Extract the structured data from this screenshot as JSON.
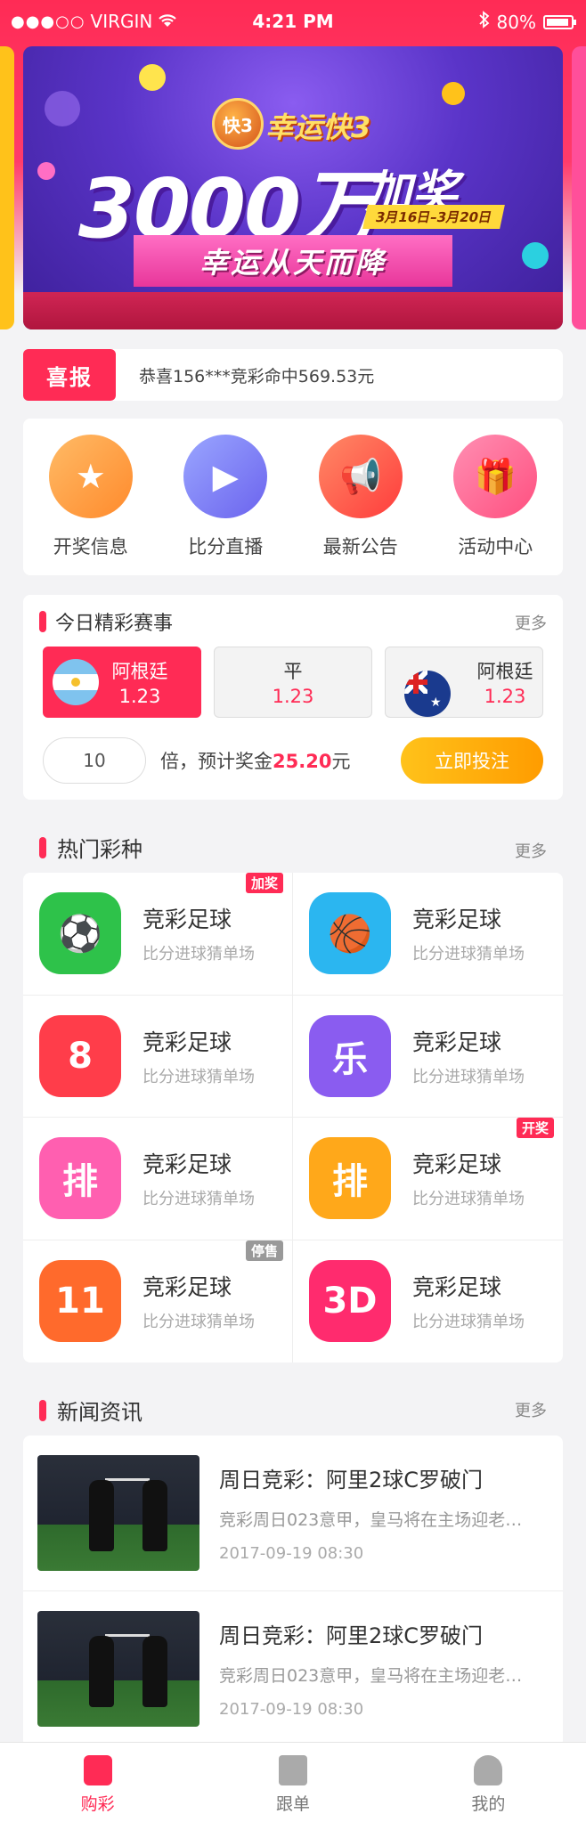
{
  "status_bar": {
    "carrier": "VIRGIN",
    "time": "4:21 PM",
    "battery": "80%"
  },
  "banner": {
    "logo_text": "快3",
    "subtitle": "幸运快3",
    "amount": "3000万",
    "bonus": "加奖",
    "date_range": "3月16日–3月20日",
    "slogan": "幸运从天而降"
  },
  "notice": {
    "tag": "喜报",
    "text": "恭喜156***竞彩命中569.53元"
  },
  "quick_entries": [
    {
      "label": "开奖信息",
      "icon": "award-icon",
      "color": "#ff9a3c"
    },
    {
      "label": "比分直播",
      "icon": "video-icon",
      "color": "#7c7cf0"
    },
    {
      "label": "最新公告",
      "icon": "megaphone-icon",
      "color": "#ff5a3c"
    },
    {
      "label": "活动中心",
      "icon": "gift-icon",
      "color": "#ff5f8f"
    }
  ],
  "match": {
    "title": "今日精彩赛事",
    "more": "更多",
    "home": {
      "name": "阿根廷",
      "odd": "1.23"
    },
    "draw": {
      "name": "平",
      "odd": "1.23"
    },
    "away": {
      "name": "阿根廷",
      "odd": "1.23"
    },
    "multiple": "10",
    "bet_prefix": "倍，预计奖金",
    "bet_amount": "25.20",
    "bet_suffix": "元",
    "bet_button": "立即投注"
  },
  "hot_lottery": {
    "title": "热门彩种",
    "more": "更多",
    "items": [
      {
        "name": "竞彩足球",
        "desc": "比分进球猜单场",
        "badge": "加奖",
        "badge_color": "#ff2b55",
        "icon": "soccer-ball-icon",
        "color": "#2ec24a"
      },
      {
        "name": "竞彩足球",
        "desc": "比分进球猜单场",
        "badge": "",
        "badge_color": "",
        "icon": "basketball-icon",
        "color": "#2bb6f0"
      },
      {
        "name": "竞彩足球",
        "desc": "比分进球猜单场",
        "badge": "",
        "badge_color": "",
        "icon": "lottery-ball-8-icon",
        "color": "#ff3d4a"
      },
      {
        "name": "竞彩足球",
        "desc": "比分进球猜单场",
        "badge": "",
        "badge_color": "",
        "icon": "lottery-ball-le-icon",
        "color": "#8a5cf0"
      },
      {
        "name": "竞彩足球",
        "desc": "比分进球猜单场",
        "badge": "",
        "badge_color": "",
        "icon": "pai-card-icon",
        "color": "#ff5fb0"
      },
      {
        "name": "竞彩足球",
        "desc": "比分进球猜单场",
        "badge": "开奖",
        "badge_color": "#ff2b55",
        "icon": "pai-card-icon",
        "color": "#ffa81a"
      },
      {
        "name": "竞彩足球",
        "desc": "比分进球猜单场",
        "badge": "停售",
        "badge_color": "#999999",
        "icon": "lottery-ball-11-icon",
        "color": "#ff6a2c"
      },
      {
        "name": "竞彩足球",
        "desc": "比分进球猜单场",
        "badge": "",
        "badge_color": "",
        "icon": "lottery-ball-3d-icon",
        "color": "#ff2b6e"
      }
    ],
    "icon_glyphs": [
      "⚽",
      "🏀",
      "8",
      "乐",
      "排",
      "排",
      "11",
      "3D"
    ]
  },
  "news": {
    "title": "新闻资讯",
    "more": "更多",
    "items": [
      {
        "title": "周日竞彩：阿里2球C罗破门",
        "summary": "竞彩周日023意甲，皇马将在主场迎老…",
        "time": "2017-09-19 08:30"
      },
      {
        "title": "周日竞彩：阿里2球C罗破门",
        "summary": "竞彩周日023意甲，皇马将在主场迎老…",
        "time": "2017-09-19 08:30"
      }
    ]
  },
  "tabbar": [
    {
      "label": "购彩",
      "icon": "shop-icon",
      "active": true
    },
    {
      "label": "跟单",
      "icon": "document-icon",
      "active": false
    },
    {
      "label": "我的",
      "icon": "user-icon",
      "active": false
    }
  ]
}
